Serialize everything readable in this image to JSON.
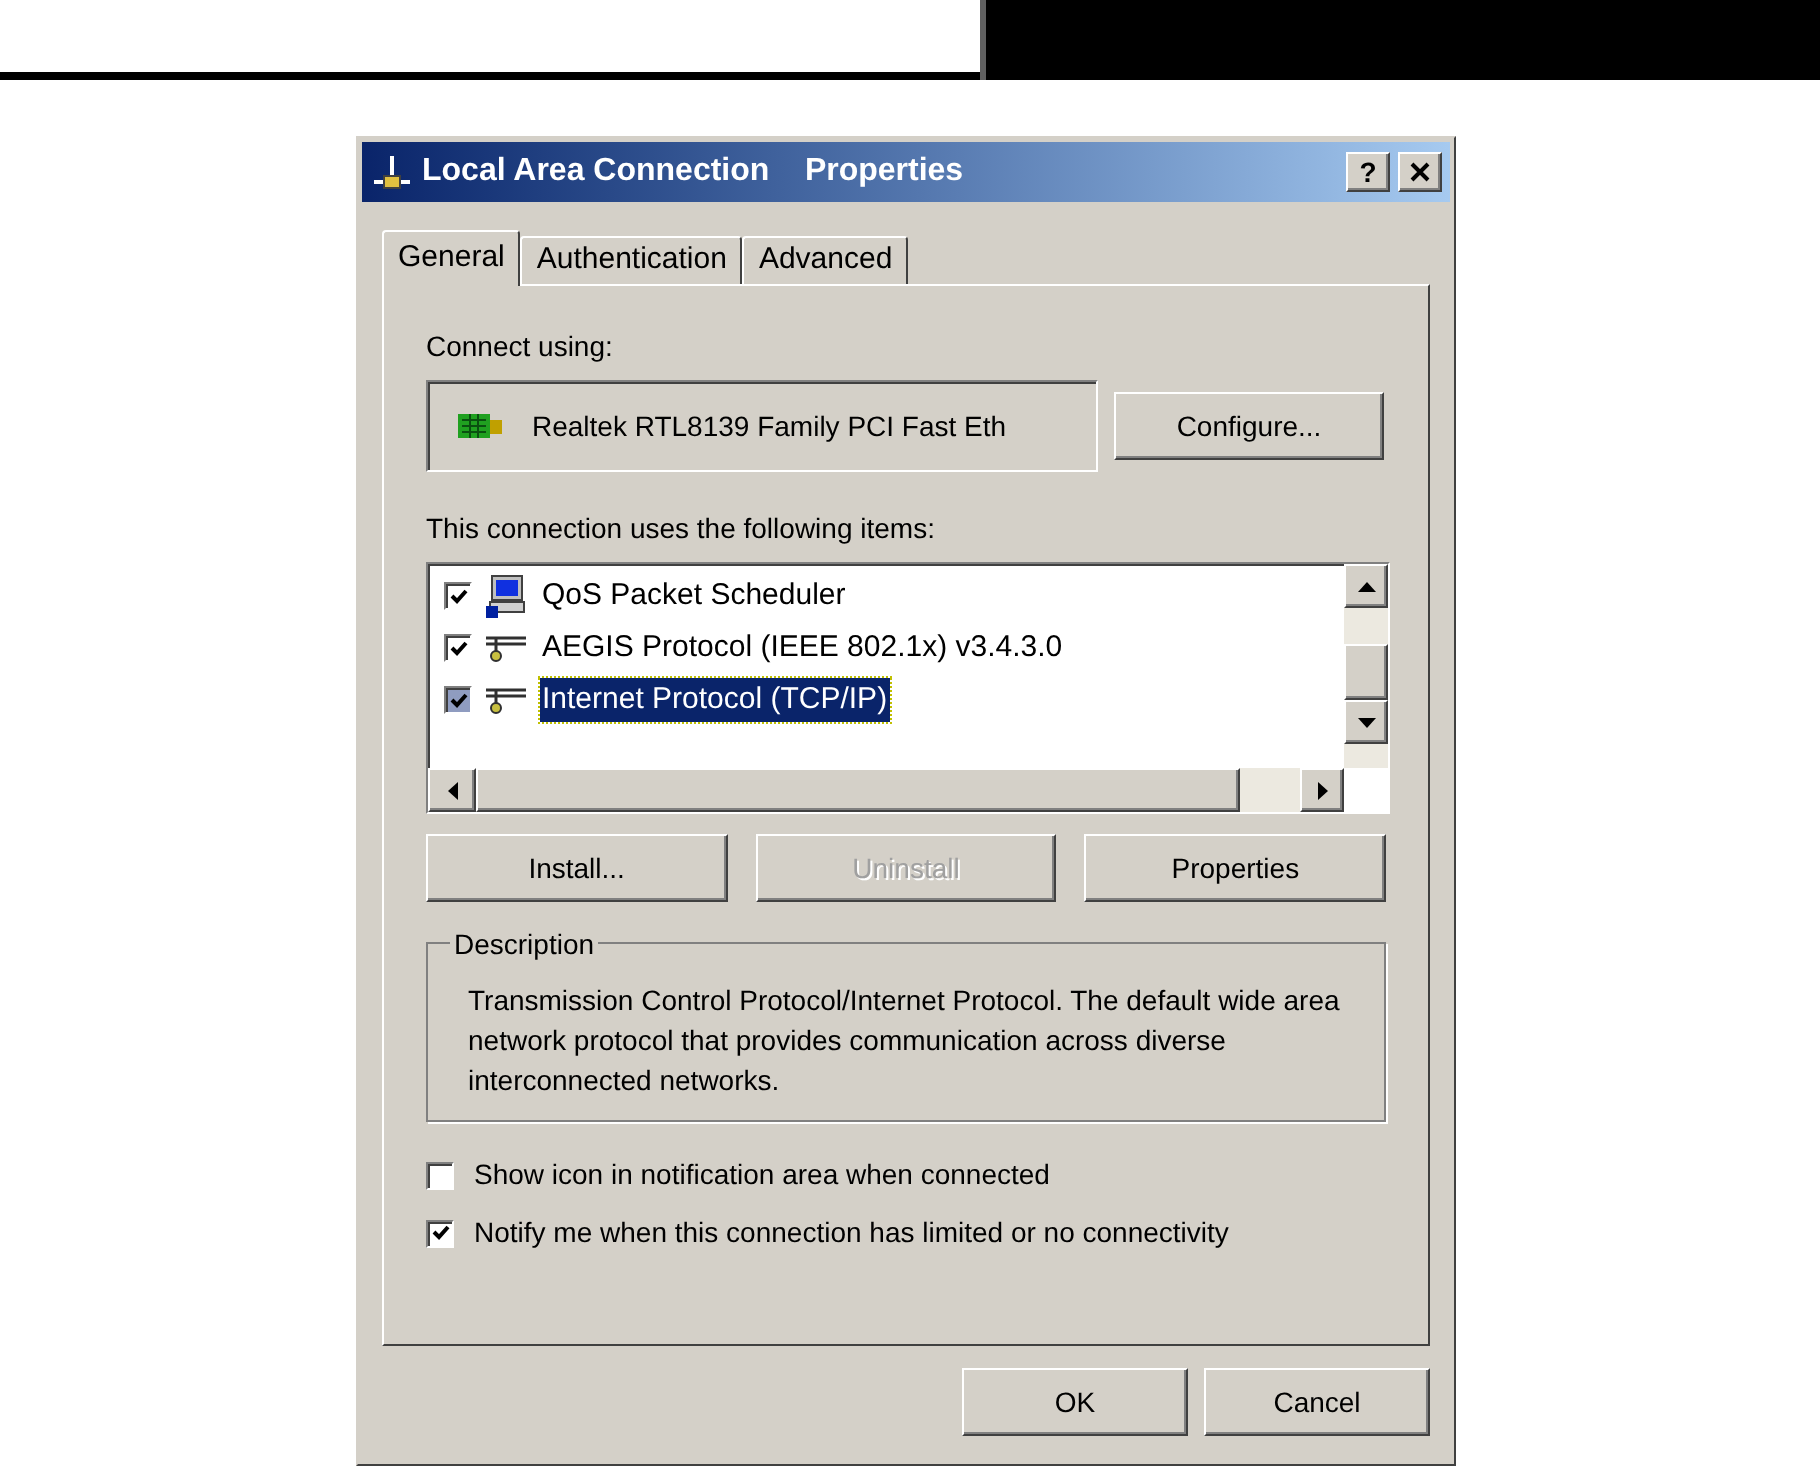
{
  "dialog": {
    "title": "Local Area Connection    Properties",
    "help_button": "?",
    "tabs": [
      {
        "label": "General",
        "selected": true
      },
      {
        "label": "Authentication",
        "selected": false
      },
      {
        "label": "Advanced",
        "selected": false
      }
    ],
    "connect_using_label": "Connect using:",
    "adapter": "Realtek RTL8139 Family PCI Fast Eth",
    "configure_button": "Configure...",
    "items_label": "This connection uses the following items:",
    "items": [
      {
        "kind": "scheduler",
        "label": "QoS Packet Scheduler",
        "checked": true,
        "selected": false
      },
      {
        "kind": "protocol",
        "label": "AEGIS Protocol (IEEE 802.1x) v3.4.3.0",
        "checked": true,
        "selected": false
      },
      {
        "kind": "protocol",
        "label": "Internet Protocol (TCP/IP)",
        "checked": true,
        "selected": true
      }
    ],
    "item_buttons": [
      {
        "label": "Install...",
        "disabled": false
      },
      {
        "label": "Uninstall",
        "disabled": true
      },
      {
        "label": "Properties",
        "disabled": false
      }
    ],
    "description": {
      "title": "Description",
      "text": "Transmission Control Protocol/Internet Protocol. The default wide area network protocol that provides communication across diverse interconnected networks."
    },
    "options": [
      {
        "label": "Show icon in notification area when connected",
        "checked": false
      },
      {
        "label": "Notify me when this connection has limited or no connectivity",
        "checked": true
      }
    ],
    "footer_buttons": [
      {
        "label": "OK"
      },
      {
        "label": "Cancel"
      }
    ]
  }
}
